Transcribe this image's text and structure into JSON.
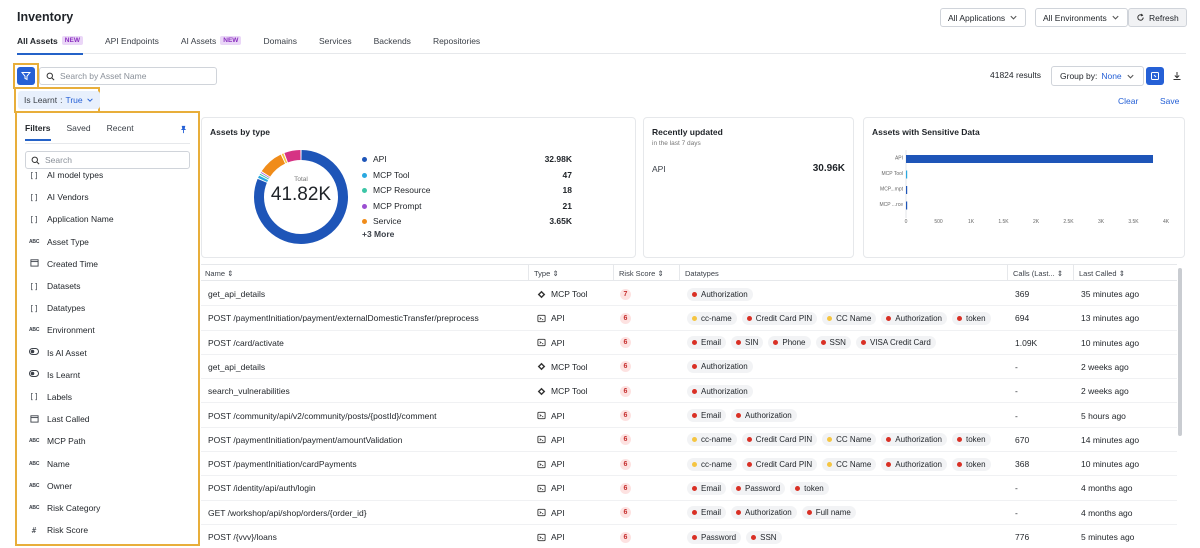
{
  "header": {
    "title": "Inventory",
    "app_select": "All Applications",
    "env_select": "All Environments",
    "refresh_label": "Refresh"
  },
  "tabs": [
    {
      "label": "All Assets",
      "badge": "NEW"
    },
    {
      "label": "API Endpoints",
      "badge": ""
    },
    {
      "label": "AI Assets",
      "badge": "NEW"
    },
    {
      "label": "Domains",
      "badge": ""
    },
    {
      "label": "Services",
      "badge": ""
    },
    {
      "label": "Backends",
      "badge": ""
    },
    {
      "label": "Repositories",
      "badge": ""
    }
  ],
  "toolbar": {
    "search_placeholder": "Search by Asset Name",
    "results": "41824 results",
    "group_by_label": "Group by:",
    "group_by_value": "None",
    "clear_label": "Clear",
    "save_label": "Save"
  },
  "active_filter": {
    "key": "Is Learnt",
    "sep": ":",
    "value": "True"
  },
  "filter_panel": {
    "tabs": [
      "Filters",
      "Saved",
      "Recent"
    ],
    "search_placeholder": "Search",
    "items": [
      {
        "label": "AI model types",
        "icon": "[]"
      },
      {
        "label": "AI Vendors",
        "icon": "[]"
      },
      {
        "label": "Application Name",
        "icon": "[]"
      },
      {
        "label": "Asset Type",
        "icon": "ABC"
      },
      {
        "label": "Created Time",
        "icon": "cal"
      },
      {
        "label": "Datasets",
        "icon": "[]"
      },
      {
        "label": "Datatypes",
        "icon": "[]"
      },
      {
        "label": "Environment",
        "icon": "ABC"
      },
      {
        "label": "Is AI Asset",
        "icon": "tog"
      },
      {
        "label": "Is Learnt",
        "icon": "tog"
      },
      {
        "label": "Labels",
        "icon": "[]"
      },
      {
        "label": "Last Called",
        "icon": "cal"
      },
      {
        "label": "MCP Path",
        "icon": "ABC"
      },
      {
        "label": "Name",
        "icon": "ABC"
      },
      {
        "label": "Owner",
        "icon": "ABC"
      },
      {
        "label": "Risk Category",
        "icon": "ABC"
      },
      {
        "label": "Risk Score",
        "icon": "#"
      }
    ]
  },
  "assets_by_type": {
    "title": "Assets by type",
    "center_label": "Total",
    "center_value": "41.82K",
    "legend": [
      {
        "label": "API",
        "value": "32.98K",
        "color": "#1e55b8"
      },
      {
        "label": "MCP Tool",
        "value": "47",
        "color": "#29a8e0"
      },
      {
        "label": "MCP Resource",
        "value": "18",
        "color": "#3cc5a6"
      },
      {
        "label": "MCP Prompt",
        "value": "21",
        "color": "#9b4fd1"
      },
      {
        "label": "Service",
        "value": "3.65K",
        "color": "#f08c1a"
      }
    ],
    "more": "+3 More"
  },
  "chart_data": {
    "type": "bar",
    "title": "Assets with Sensitive Data",
    "orientation": "horizontal",
    "categories": [
      "API",
      "MCP Tool",
      "MCP...mpt",
      "MCP ...rce"
    ],
    "values": [
      3800,
      8,
      3,
      3
    ],
    "xticks": [
      "0",
      "500",
      "1K",
      "1.5K",
      "2K",
      "2.5K",
      "3K",
      "3.5K",
      "4K"
    ],
    "xlim": [
      0,
      4000
    ],
    "color": "#1e55b8"
  },
  "recently_updated": {
    "title": "Recently updated",
    "subtitle": "in the last 7 days",
    "label": "API",
    "value": "30.96K"
  },
  "table": {
    "columns": {
      "name": "Name",
      "type": "Type",
      "risk": "Risk Score",
      "datatypes": "Datatypes",
      "calls": "Calls (Last...",
      "last_called": "Last Called"
    },
    "rows": [
      {
        "name": "get_api_details",
        "type": "MCP Tool",
        "risk": "7",
        "datatypes": [
          {
            "label": "Authorization",
            "color": "#d93025"
          }
        ],
        "calls": "369",
        "last_called": "35 minutes ago"
      },
      {
        "name": "POST /paymentInitiation/payment/externalDomesticTransfer/preprocess",
        "type": "API",
        "risk": "6",
        "datatypes": [
          {
            "label": "cc-name",
            "color": "#f5c542"
          },
          {
            "label": "Credit Card PIN",
            "color": "#d93025"
          },
          {
            "label": "CC Name",
            "color": "#f5c542"
          },
          {
            "label": "Authorization",
            "color": "#d93025"
          },
          {
            "label": "token",
            "color": "#d93025"
          }
        ],
        "calls": "694",
        "last_called": "13 minutes ago"
      },
      {
        "name": "POST /card/activate",
        "type": "API",
        "risk": "6",
        "datatypes": [
          {
            "label": "Email",
            "color": "#d93025"
          },
          {
            "label": "SIN",
            "color": "#d93025"
          },
          {
            "label": "Phone",
            "color": "#d93025"
          },
          {
            "label": "SSN",
            "color": "#d93025"
          },
          {
            "label": "VISA Credit Card",
            "color": "#d93025"
          }
        ],
        "calls": "1.09K",
        "last_called": "10 minutes ago"
      },
      {
        "name": "get_api_details",
        "type": "MCP Tool",
        "risk": "6",
        "datatypes": [
          {
            "label": "Authorization",
            "color": "#d93025"
          }
        ],
        "calls": "-",
        "last_called": "2 weeks ago"
      },
      {
        "name": "search_vulnerabilities",
        "type": "MCP Tool",
        "risk": "6",
        "datatypes": [
          {
            "label": "Authorization",
            "color": "#d93025"
          }
        ],
        "calls": "-",
        "last_called": "2 weeks ago"
      },
      {
        "name": "POST /community/api/v2/community/posts/{postId}/comment",
        "type": "API",
        "risk": "6",
        "datatypes": [
          {
            "label": "Email",
            "color": "#d93025"
          },
          {
            "label": "Authorization",
            "color": "#d93025"
          }
        ],
        "calls": "-",
        "last_called": "5 hours ago"
      },
      {
        "name": "POST /paymentInitiation/payment/amountValidation",
        "type": "API",
        "risk": "6",
        "datatypes": [
          {
            "label": "cc-name",
            "color": "#f5c542"
          },
          {
            "label": "Credit Card PIN",
            "color": "#d93025"
          },
          {
            "label": "CC Name",
            "color": "#f5c542"
          },
          {
            "label": "Authorization",
            "color": "#d93025"
          },
          {
            "label": "token",
            "color": "#d93025"
          }
        ],
        "calls": "670",
        "last_called": "14 minutes ago"
      },
      {
        "name": "POST /paymentInitiation/cardPayments",
        "type": "API",
        "risk": "6",
        "datatypes": [
          {
            "label": "cc-name",
            "color": "#f5c542"
          },
          {
            "label": "Credit Card PIN",
            "color": "#d93025"
          },
          {
            "label": "CC Name",
            "color": "#f5c542"
          },
          {
            "label": "Authorization",
            "color": "#d93025"
          },
          {
            "label": "token",
            "color": "#d93025"
          }
        ],
        "calls": "368",
        "last_called": "10 minutes ago"
      },
      {
        "name": "POST /identity/api/auth/login",
        "type": "API",
        "risk": "6",
        "datatypes": [
          {
            "label": "Email",
            "color": "#d93025"
          },
          {
            "label": "Password",
            "color": "#d93025"
          },
          {
            "label": "token",
            "color": "#d93025"
          }
        ],
        "calls": "-",
        "last_called": "4 months ago"
      },
      {
        "name": "GET /workshop/api/shop/orders/{order_id}",
        "type": "API",
        "risk": "6",
        "datatypes": [
          {
            "label": "Email",
            "color": "#d93025"
          },
          {
            "label": "Authorization",
            "color": "#d93025"
          },
          {
            "label": "Full name",
            "color": "#d93025"
          }
        ],
        "calls": "-",
        "last_called": "4 months ago"
      },
      {
        "name": "POST /{vvv}/loans",
        "type": "API",
        "risk": "6",
        "datatypes": [
          {
            "label": "Password",
            "color": "#d93025"
          },
          {
            "label": "SSN",
            "color": "#d93025"
          }
        ],
        "calls": "776",
        "last_called": "5 minutes ago"
      }
    ]
  },
  "colors": {
    "accent": "#2560d6",
    "highlight": "#e8ae3a"
  }
}
